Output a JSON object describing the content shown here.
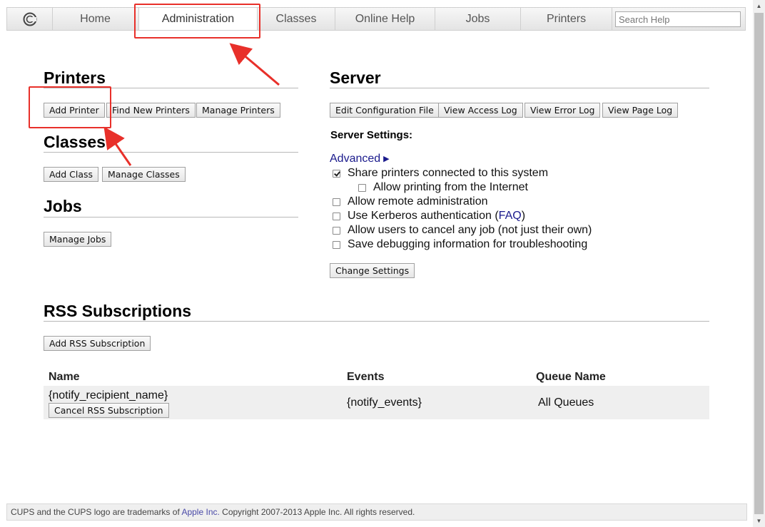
{
  "nav": {
    "tabs": [
      "Home",
      "Administration",
      "Classes",
      "Online Help",
      "Jobs",
      "Printers"
    ],
    "active_tab": "Administration",
    "search_placeholder": "Search Help"
  },
  "printers": {
    "heading": "Printers",
    "add_printer": "Add Printer",
    "find_new": "Find New Printers",
    "manage": "Manage Printers"
  },
  "classes": {
    "heading": "Classes",
    "add_class": "Add Class",
    "manage": "Manage Classes"
  },
  "jobs": {
    "heading": "Jobs",
    "manage": "Manage Jobs"
  },
  "server": {
    "heading": "Server",
    "buttons": [
      "Edit Configuration File",
      "View Access Log",
      "View Error Log",
      "View Page Log"
    ],
    "settings_label": "Server Settings:",
    "advanced": "Advanced",
    "advanced_arrow": "▶",
    "options": [
      {
        "label": "Share printers connected to this system",
        "checked": true
      },
      {
        "label": "Allow printing from the Internet",
        "checked": false
      },
      {
        "label": "Allow remote administration",
        "checked": false
      },
      {
        "label": "Use Kerberos authentication (",
        "link": "FAQ",
        "suffix": ")",
        "checked": false
      },
      {
        "label": "Allow users to cancel any job (not just their own)",
        "checked": false
      },
      {
        "label": "Save debugging information for troubleshooting",
        "checked": false
      }
    ],
    "change_settings": "Change Settings"
  },
  "rss": {
    "heading": "RSS Subscriptions",
    "add": "Add RSS Subscription",
    "columns": [
      "Name",
      "Events",
      "Queue Name"
    ],
    "rows": [
      {
        "name": "{notify_recipient_name}",
        "cancel": "Cancel RSS Subscription",
        "events": "{notify_events}",
        "queue": "All Queues"
      }
    ]
  },
  "footer": {
    "prefix": "CUPS and the CUPS logo are trademarks of ",
    "link": "Apple Inc.",
    "suffix": " Copyright 2007-2013 Apple Inc. All rights reserved."
  },
  "colors": {
    "annotation": "#e8302a",
    "link": "#1a1a8c"
  }
}
